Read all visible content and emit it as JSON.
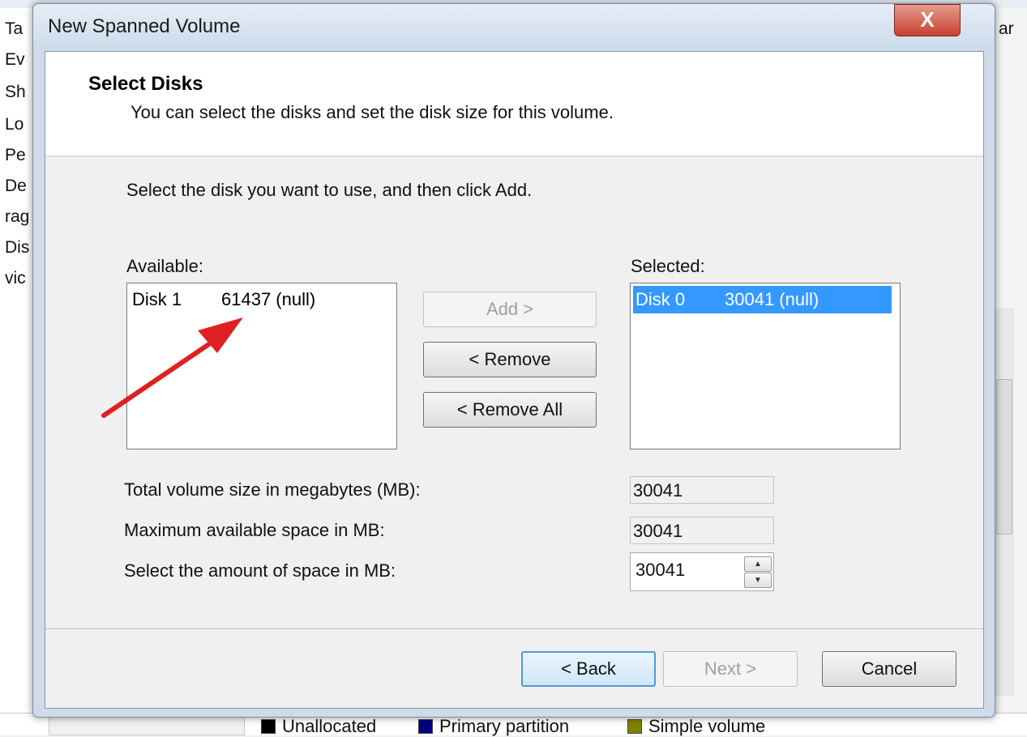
{
  "background": {
    "left_items": [
      "Ta",
      "Ev",
      "Sh",
      "Lo",
      "Pe",
      "De",
      "rag",
      "Dis",
      "vic"
    ],
    "right_text": "ar",
    "legend": [
      {
        "label": "Unallocated",
        "color": "#000000"
      },
      {
        "label": "Primary partition",
        "color": "#000080"
      },
      {
        "label": "Simple volume",
        "color": "#808000"
      }
    ]
  },
  "dialog": {
    "title": "New Spanned Volume",
    "close_label": "X",
    "header_title": "Select Disks",
    "header_subtitle": "You can select the disks and set the disk size for this volume.",
    "instruction": "Select the disk you want to use, and then click Add.",
    "available_label": "Available:",
    "selected_label": "Selected:",
    "available_items": [
      {
        "disk": "Disk 1",
        "info": "61437 (null)"
      }
    ],
    "selected_items": [
      {
        "disk": "Disk 0",
        "info": "30041 (null)"
      }
    ],
    "buttons": {
      "add": "Add >",
      "remove": "< Remove",
      "remove_all": "< Remove All",
      "back": "< Back",
      "next": "Next >",
      "cancel": "Cancel"
    },
    "fields": {
      "total_label": "Total volume size in megabytes (MB):",
      "total_value": "30041",
      "max_label": "Maximum available space in MB:",
      "max_value": "30041",
      "amount_label": "Select the amount of space in MB:",
      "amount_value": "30041"
    }
  },
  "colors": {
    "selection": "#3399ff",
    "annotation_arrow": "#e02020"
  }
}
